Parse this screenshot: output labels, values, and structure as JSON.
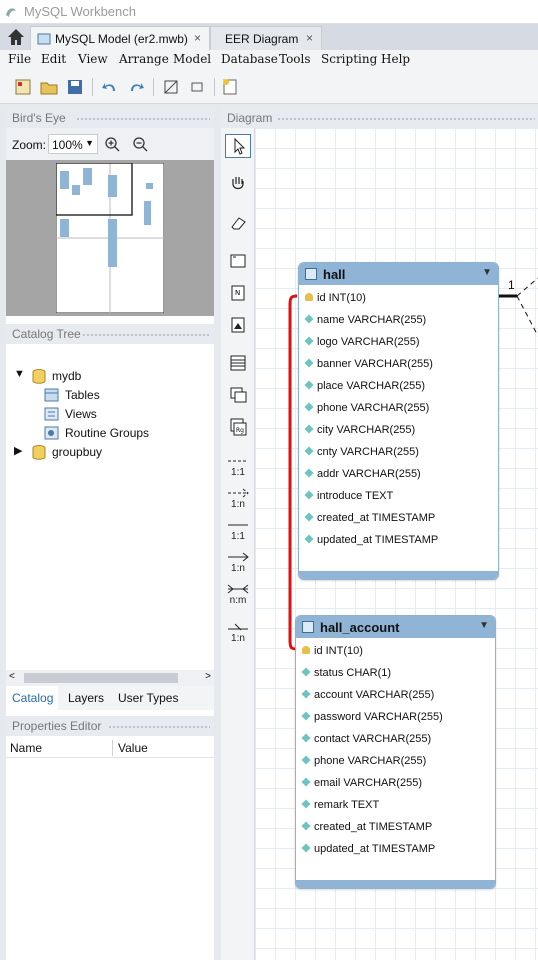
{
  "app": {
    "title": "MySQL Workbench"
  },
  "tabs": [
    {
      "label": "MySQL Model (er2.mwb)",
      "close": "×"
    },
    {
      "label": "EER Diagram",
      "close": "×"
    }
  ],
  "menu": [
    "File",
    "Edit",
    "View",
    "Arrange",
    "Model",
    "Database",
    "Tools",
    "Scripting",
    "Help"
  ],
  "toolbar": {
    "icons": [
      "new-model-icon",
      "open-model-icon",
      "save-model-icon",
      "undo-icon",
      "redo-icon",
      "toggle-grid-icon",
      "align-icon",
      "new-diagram-icon"
    ]
  },
  "birdseye": {
    "title": "Bird's Eye",
    "zoom_label": "Zoom:",
    "zoom_value": "100%"
  },
  "catalog": {
    "title": "Catalog Tree",
    "items": [
      {
        "label": "mydb",
        "children": [
          "Tables",
          "Views",
          "Routine Groups"
        ]
      },
      {
        "label": "groupbuy"
      }
    ]
  },
  "bottom_tabs": [
    "Catalog",
    "Layers",
    "User Types"
  ],
  "properties": {
    "title": "Properties Editor",
    "col_name": "Name",
    "col_value": "Value"
  },
  "diagram": {
    "title": "Diagram",
    "relation_labels": [
      "1:1",
      "1:n",
      "1:1",
      "1:n",
      "n:m",
      "1:n"
    ],
    "card_1": "1"
  },
  "tables": [
    {
      "name": "hall",
      "columns": [
        {
          "text": "id INT(10)",
          "pk": true
        },
        {
          "text": "name VARCHAR(255)"
        },
        {
          "text": "logo VARCHAR(255)"
        },
        {
          "text": "banner VARCHAR(255)"
        },
        {
          "text": "place VARCHAR(255)"
        },
        {
          "text": "phone VARCHAR(255)"
        },
        {
          "text": "city VARCHAR(255)"
        },
        {
          "text": "cnty VARCHAR(255)"
        },
        {
          "text": "addr VARCHAR(255)"
        },
        {
          "text": "introduce TEXT"
        },
        {
          "text": "created_at TIMESTAMP"
        },
        {
          "text": "updated_at TIMESTAMP"
        }
      ]
    },
    {
      "name": "hall_account",
      "columns": [
        {
          "text": "id INT(10)",
          "pk": true
        },
        {
          "text": "status CHAR(1)"
        },
        {
          "text": "account VARCHAR(255)"
        },
        {
          "text": "password VARCHAR(255)"
        },
        {
          "text": "contact VARCHAR(255)"
        },
        {
          "text": "phone VARCHAR(255)"
        },
        {
          "text": "email VARCHAR(255)"
        },
        {
          "text": "remark TEXT"
        },
        {
          "text": "created_at TIMESTAMP"
        },
        {
          "text": "updated_at TIMESTAMP"
        }
      ]
    }
  ],
  "colors": {
    "table_header": "#8fb4d6",
    "annotation": "#e01010"
  }
}
